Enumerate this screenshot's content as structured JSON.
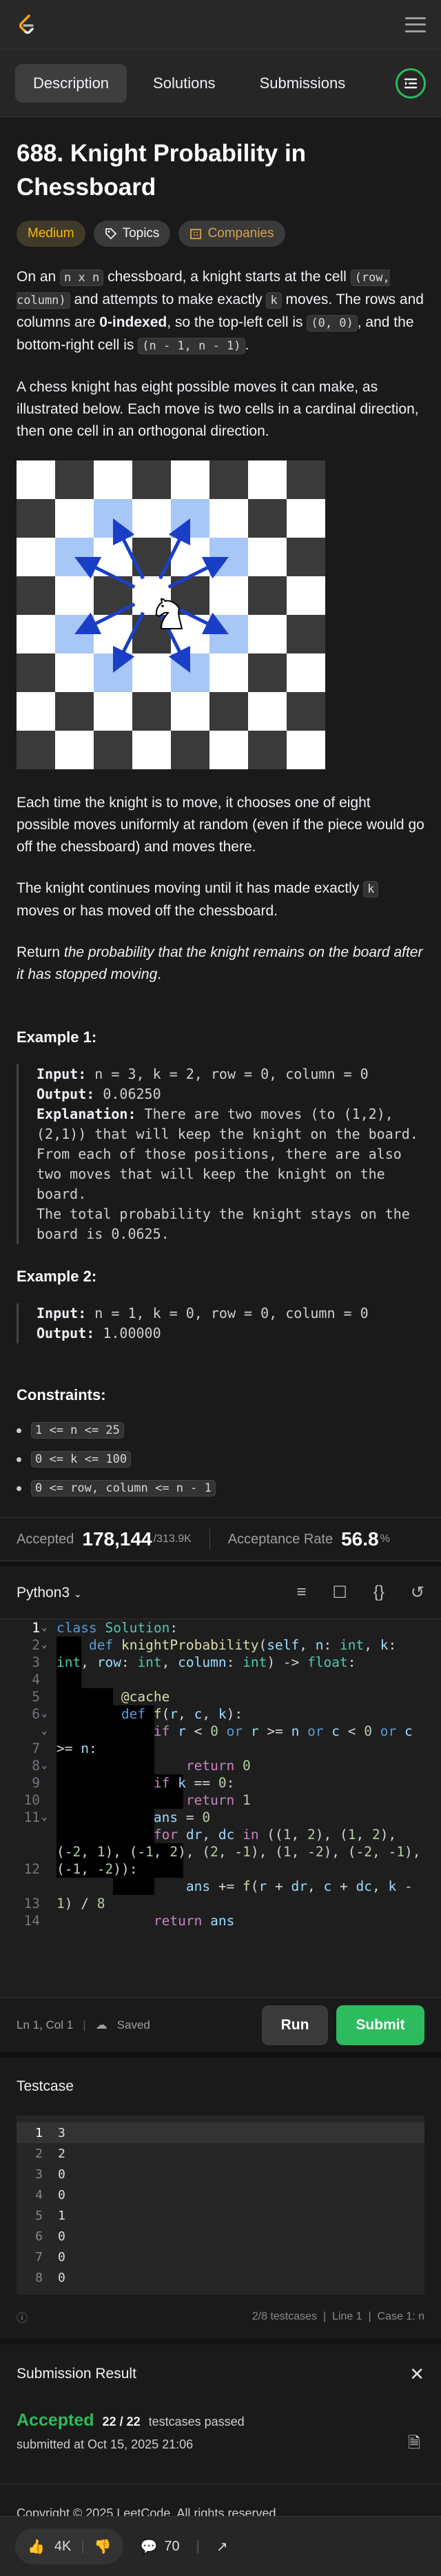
{
  "tabs": [
    "Description",
    "Solutions",
    "Submissions"
  ],
  "problem": {
    "title": "688. Knight Probability in Chessboard",
    "difficulty": "Medium",
    "topics": "Topics",
    "companies": "Companies"
  },
  "desc": {
    "p1": [
      "On an ",
      "n x n",
      " chessboard, a knight starts at the cell ",
      "(row, column)",
      " and attempts to make exactly ",
      "k",
      " moves. The rows and columns are ",
      "0-indexed",
      ", so the top-left cell is ",
      "(0, 0)",
      ", and the bottom-right cell is ",
      "(n - 1, n - 1)",
      "."
    ],
    "p2": "A chess knight has eight possible moves it can make, as illustrated below. Each move is two cells in a cardinal direction, then one cell in an orthogonal direction.",
    "p3": "Each time the knight is to move, it chooses one of eight possible moves uniformly at random (even if the piece would go off the chessboard) and moves there.",
    "p4a": "The knight continues moving until it has made exactly ",
    "p4k": "k",
    "p4b": " moves or has moved off the chessboard.",
    "p5a": "Return ",
    "p5b": "the probability that the knight remains on the board after it has stopped moving",
    "p5c": "."
  },
  "example1": {
    "heading": "Example 1:",
    "input_label": "Input:",
    "input": " n = 3, k = 2, row = 0, column = 0",
    "output_label": "Output:",
    "output": " 0.06250",
    "expl_label": "Explanation:",
    "expl": [
      " There are two moves (to (1,2), (2,1)) that will keep the knight on the board.",
      "From each of those positions, there are also two moves that will keep the knight on the board.",
      "The total probability the knight stays on the board is 0.0625."
    ]
  },
  "example2": {
    "heading": "Example 2:",
    "input_label": "Input:",
    "input": " n = 1, k = 0, row = 0, column = 0",
    "output_label": "Output:",
    "output": " 1.00000"
  },
  "constraints": {
    "heading": "Constraints:",
    "items": [
      "1 <= n <= 25",
      "0 <= k <= 100",
      "0 <= row, column <= n - 1"
    ]
  },
  "stats": {
    "accepted_label": "Accepted",
    "accepted": "178,144",
    "total": "/313.9K",
    "rate_label": "Acceptance Rate",
    "rate": "56.8",
    "rate_unit": "%"
  },
  "editor": {
    "language": "Python3",
    "status": "Ln 1, Col 1",
    "saved": "Saved",
    "run": "Run",
    "submit": "Submit"
  },
  "testcase": {
    "title": "Testcase",
    "lines": [
      "3",
      "2",
      "0",
      "0",
      "1",
      "0",
      "0",
      "0"
    ],
    "footer_count": "2/8 testcases",
    "footer_line": "Line 1",
    "footer_case": "Case 1: n"
  },
  "submission": {
    "title": "Submission Result",
    "status": "Accepted",
    "passed": "22 / 22",
    "passed_label": "testcases passed",
    "submitted": "submitted at Oct 15, 2025 21:06"
  },
  "footer": "Copyright © 2025 LeetCode. All rights reserved.",
  "bottombar": {
    "likes": "4K",
    "comments": "70"
  },
  "colors": {
    "accent": "#2cbb5d",
    "medium": "#ffb800",
    "board_dark": "#3a3a3a",
    "board_light": "#ffffff",
    "board_blue": "#a7c7f7",
    "arrow": "#1a3fc7"
  }
}
